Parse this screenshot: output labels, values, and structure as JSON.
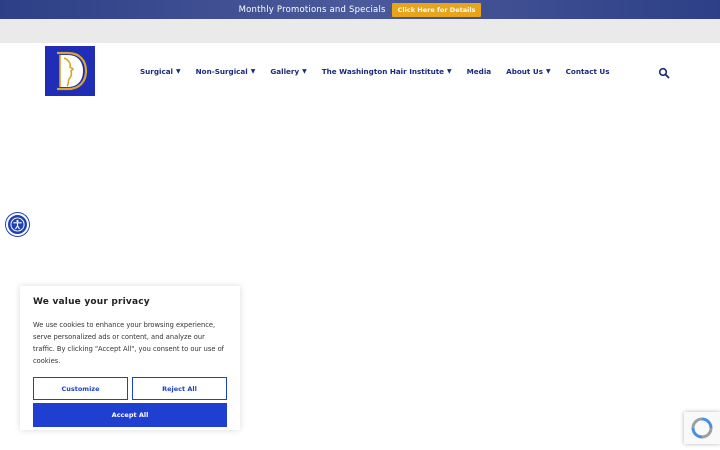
{
  "promo": {
    "text": "Monthly Promotions and Specials",
    "button_label": "Click Here for Details"
  },
  "nav": {
    "items": [
      {
        "label": "Surgical",
        "has_dropdown": true
      },
      {
        "label": "Non-Surgical",
        "has_dropdown": true
      },
      {
        "label": "Gallery",
        "has_dropdown": true
      },
      {
        "label": "The Washington Hair Institute",
        "has_dropdown": true
      },
      {
        "label": "Media",
        "has_dropdown": false
      },
      {
        "label": "About Us",
        "has_dropdown": true
      },
      {
        "label": "Contact Us",
        "has_dropdown": false
      }
    ],
    "caret": "▼",
    "search_icon": "search-icon"
  },
  "cookie": {
    "title": "We value your privacy",
    "body": "We use cookies to enhance your browsing experience, serve personalized ads or content, and analyze our traffic. By clicking \"Accept All\", you consent to our use of cookies.",
    "customize_label": "Customize",
    "reject_label": "Reject All",
    "accept_label": "Accept All"
  },
  "colors": {
    "brand_blue": "#1f3fd1",
    "logo_bg": "#1f2eb5",
    "logo_gold": "#d9a52a",
    "promo_button": "#e8a41a",
    "nav_text": "#1a2a7c"
  }
}
